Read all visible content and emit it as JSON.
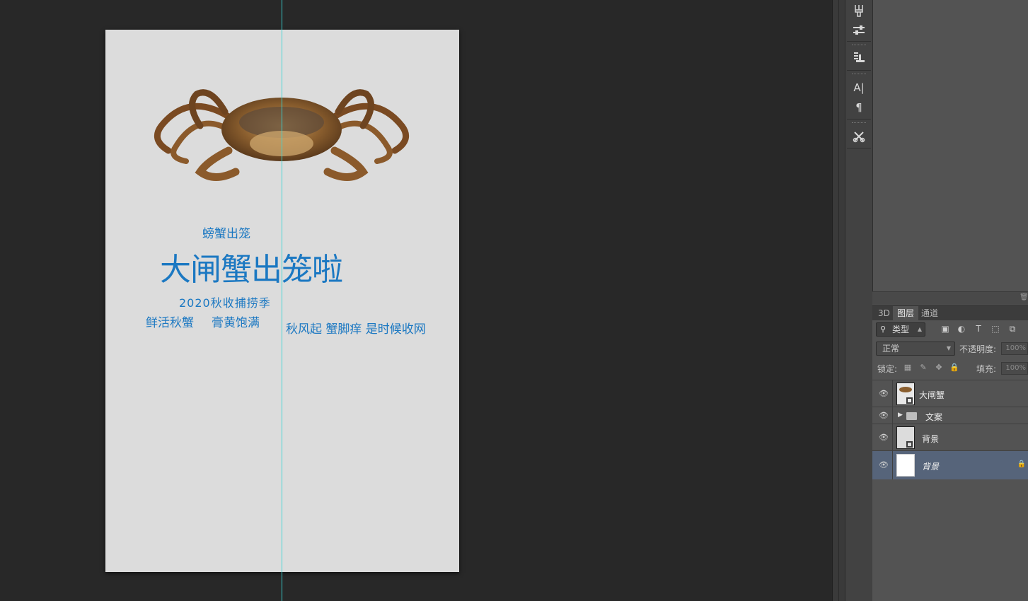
{
  "document": {
    "texts": {
      "subtitle": "螃蟹出笼",
      "headline": "大闸蟹出笼啦",
      "season": "2020秋收捕捞季",
      "tag_fresh": "鲜活秋蟹",
      "tag_full": "膏黄饱满",
      "slogan": "秋风起 蟹脚痒 是时候收网"
    },
    "text_color": "#1b78c2",
    "background_color": "#dcdcdc",
    "guide_color": "#39d7d7"
  },
  "dock": {
    "icons": [
      "brush-presets-icon",
      "adjustments-icon",
      "paragraph-styles-icon",
      "character-icon",
      "paragraph-icon",
      "tool-presets-icon"
    ],
    "labels": {
      "character": "A|",
      "paragraph": "¶"
    }
  },
  "layers_panel": {
    "tabs": [
      "3D",
      "图层",
      "通道"
    ],
    "active_tab": "图层",
    "filter": {
      "label": "类型"
    },
    "blend_mode": "正常",
    "opacity_label": "不透明度:",
    "opacity_value": "100%",
    "lock_label": "锁定:",
    "fill_label": "填充:",
    "fill_value": "100%",
    "layers": [
      {
        "name": "大闸蟹",
        "type": "smart-object",
        "visible": true,
        "selected": false
      },
      {
        "name": "文案",
        "type": "group",
        "visible": true,
        "selected": false
      },
      {
        "name": "背景",
        "type": "smart-object",
        "visible": true,
        "selected": false
      },
      {
        "name": "背景",
        "type": "background",
        "visible": true,
        "selected": true,
        "locked": true
      }
    ]
  }
}
